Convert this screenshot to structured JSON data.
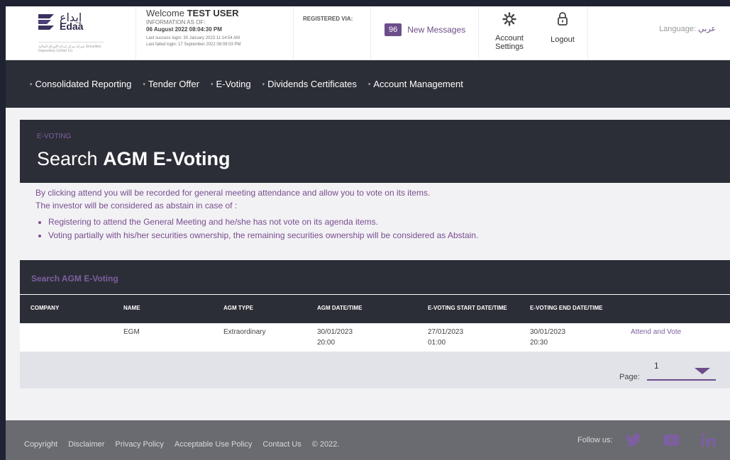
{
  "header": {
    "logo_ar": "إيداع",
    "logo_en": "Edaa",
    "logo_tagline": "شركة مركز إيداع الأوراق المالية\nSecurities Depository Center Co.",
    "welcome_prefix": "Welcome",
    "username": "TEST USER",
    "info_as_of_label": "INFORMATION AS OF:",
    "info_as_of_date": "06 August 2022 08:04:30 PM",
    "last_success": "Last success login: 30 January 2023 11:14:54 AM",
    "last_failed": "Last failed login: 17 September 2022 08:09:03 PM",
    "registered_via": "REGISTERED VIA:",
    "messages_count": "96",
    "messages_label": "New Messages",
    "account_settings": "Account Settings",
    "logout": "Logout",
    "language_label": "Language:",
    "language_value": "عربي"
  },
  "nav": {
    "items": [
      {
        "label": "Consolidated Reporting"
      },
      {
        "label": "Tender Offer"
      },
      {
        "label": "E-Voting"
      },
      {
        "label": "Dividends Certificates"
      },
      {
        "label": "Account Management"
      }
    ]
  },
  "banner": {
    "breadcrumb": "E-VOTING",
    "title_prefix": "Search",
    "title_bold": "AGM E-Voting"
  },
  "info": {
    "line1": "By clicking attend you will be recorded for general meeting attendance and allow you to vote on its items.",
    "line2": "The investor will be considered as abstain in case of :",
    "bullets": [
      "Registering to attend the General Meeting and he/she has not vote on its agenda items.",
      "Voting partially with his/her securities ownership, the remaining securities ownership will be considered as Abstain."
    ]
  },
  "table": {
    "title": "Search AGM E-Voting",
    "columns": [
      "COMPANY",
      "NAME",
      "AGM TYPE",
      "AGM DATE/TIME",
      "E-VOTING START DATE/TIME",
      "E-VOTING END DATE/TIME"
    ],
    "rows": [
      {
        "company": "",
        "name": "EGM",
        "agm_type": "Extraordinary",
        "agm_date": "30/01/2023",
        "agm_time": "20:00",
        "start_date": "27/01/2023",
        "start_time": "01:00",
        "end_date": "30/01/2023",
        "end_time": "20:30",
        "action": "Attend and Vote"
      }
    ],
    "page_label": "Page:",
    "page_value": "1"
  },
  "footer": {
    "links": [
      "Copyright",
      "Disclaimer",
      "Privacy Policy",
      "Acceptable Use Policy",
      "Contact Us",
      "© 2022."
    ],
    "follow_label": "Follow us:",
    "social_icons": [
      "twitter-icon",
      "youtube-icon",
      "linkedin-icon"
    ]
  },
  "colors": {
    "accent": "#6c4d8a",
    "dark": "#2c2e37",
    "footer": "#6a6b70"
  }
}
